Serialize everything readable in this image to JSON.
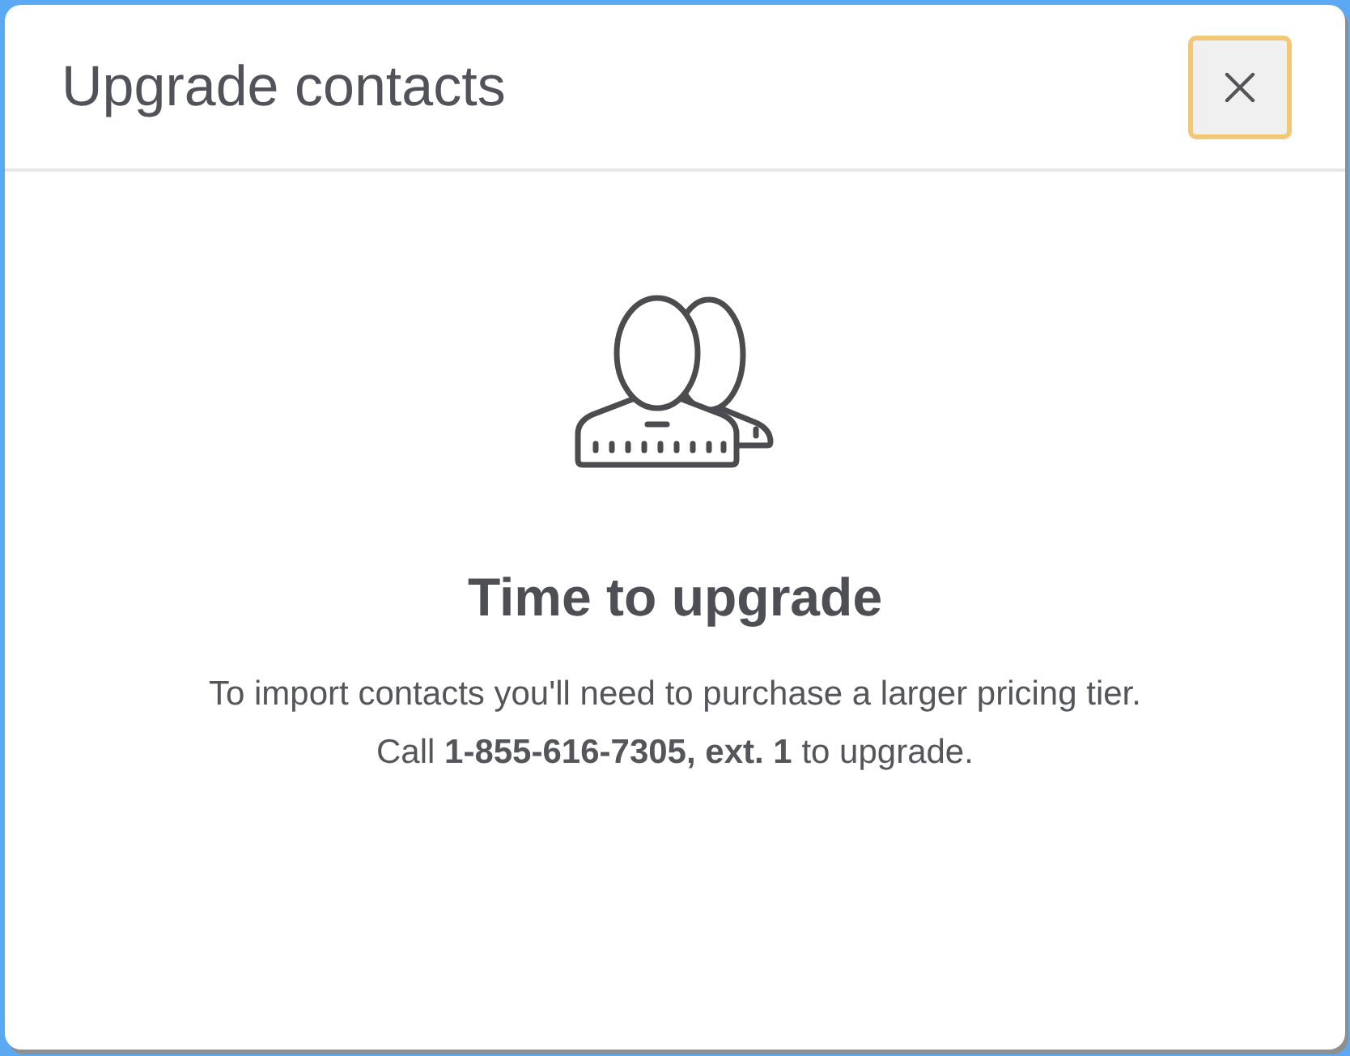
{
  "dialog": {
    "title": "Upgrade contacts",
    "close_button": {
      "focused": true
    }
  },
  "body": {
    "heading": "Time to upgrade",
    "message_lines": [
      "To import contacts you'll need to purchase a larger pricing tier.",
      "Call **1-855-616-7305, ext. 1** to upgrade."
    ]
  }
}
